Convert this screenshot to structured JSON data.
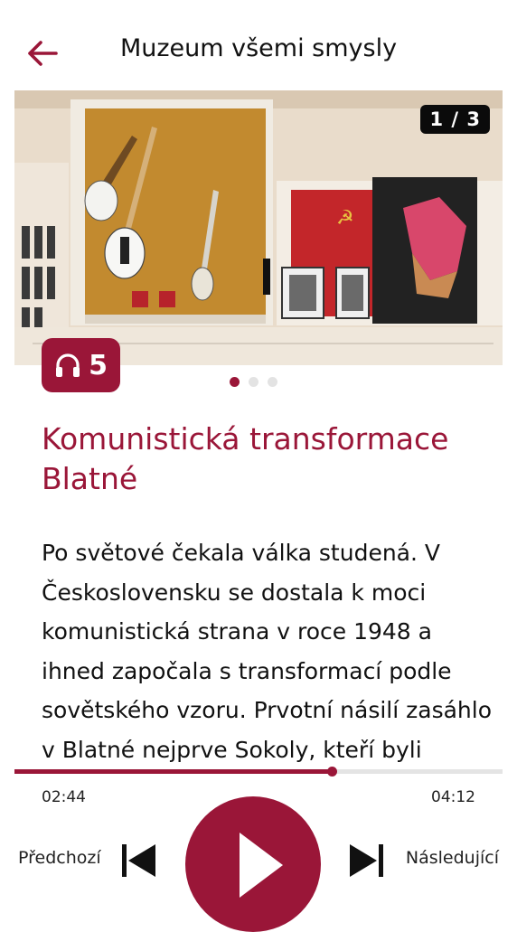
{
  "header": {
    "title": "Muzeum všemi smysly"
  },
  "carousel": {
    "counter": "1 / 3",
    "current_index": 1,
    "total": 3
  },
  "audio_badge": {
    "number": "5"
  },
  "article": {
    "title": "Komunistická transformace Blatné",
    "body": "Po světové čekala válka studená. V Československu se dostala k moci komunistická strana v roce 1948 a ihned započala s transformací podle sovětského vzoru. Prvotní násilí zasáhlo v Blatné nejprve Sokoly, kteří byli bedlivě sledováni při odjezdu na"
  },
  "player": {
    "elapsed": "02:44",
    "total": "04:12",
    "progress_fraction": 0.65,
    "prev_label": "Předchozí",
    "next_label": "Následující"
  },
  "colors": {
    "accent": "#9a1638",
    "text": "#111111",
    "track": "#e4e4e4"
  },
  "icons": {
    "back": "arrow-left-icon",
    "audio": "headphones-icon",
    "prev": "skip-previous-icon",
    "play": "play-icon",
    "next": "skip-next-icon"
  }
}
